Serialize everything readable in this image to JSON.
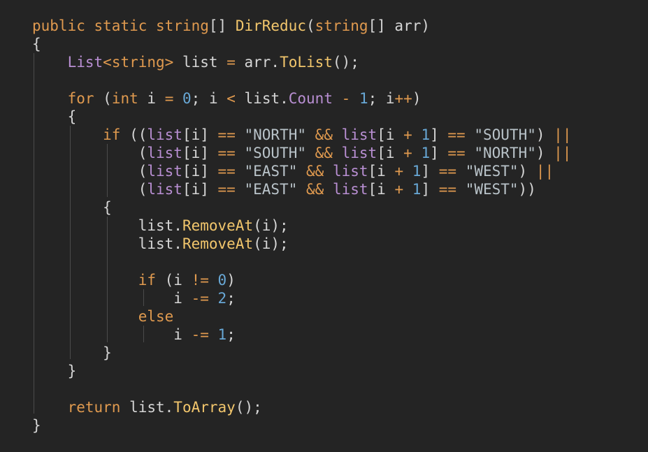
{
  "code": {
    "lines": [
      [
        {
          "t": "public",
          "c": "kw"
        },
        {
          "t": " ",
          "c": "pn"
        },
        {
          "t": "static",
          "c": "kw"
        },
        {
          "t": " ",
          "c": "pn"
        },
        {
          "t": "string",
          "c": "kw"
        },
        {
          "t": "[] ",
          "c": "pn"
        },
        {
          "t": "DirReduc",
          "c": "fn"
        },
        {
          "t": "(",
          "c": "pn"
        },
        {
          "t": "string",
          "c": "kw"
        },
        {
          "t": "[] arr)",
          "c": "pn"
        }
      ],
      [
        {
          "t": "{",
          "c": "pn"
        }
      ],
      [
        {
          "t": "    ",
          "c": "pn"
        },
        {
          "t": "List",
          "c": "ty"
        },
        {
          "t": "<",
          "c": "op"
        },
        {
          "t": "string",
          "c": "kw"
        },
        {
          "t": ">",
          "c": "op"
        },
        {
          "t": " list ",
          "c": "pn"
        },
        {
          "t": "=",
          "c": "op"
        },
        {
          "t": " arr.",
          "c": "pn"
        },
        {
          "t": "ToList",
          "c": "fn"
        },
        {
          "t": "();",
          "c": "pn"
        }
      ],
      [],
      [
        {
          "t": "    ",
          "c": "pn"
        },
        {
          "t": "for",
          "c": "kw"
        },
        {
          "t": " (",
          "c": "pn"
        },
        {
          "t": "int",
          "c": "kw"
        },
        {
          "t": " i ",
          "c": "pn"
        },
        {
          "t": "=",
          "c": "op"
        },
        {
          "t": " ",
          "c": "pn"
        },
        {
          "t": "0",
          "c": "num"
        },
        {
          "t": "; i ",
          "c": "pn"
        },
        {
          "t": "<",
          "c": "op"
        },
        {
          "t": " list.",
          "c": "pn"
        },
        {
          "t": "Count",
          "c": "ty"
        },
        {
          "t": " ",
          "c": "pn"
        },
        {
          "t": "-",
          "c": "op"
        },
        {
          "t": " ",
          "c": "pn"
        },
        {
          "t": "1",
          "c": "num"
        },
        {
          "t": "; i",
          "c": "pn"
        },
        {
          "t": "++",
          "c": "op"
        },
        {
          "t": ")",
          "c": "pn"
        }
      ],
      [
        {
          "t": "    {",
          "c": "pn"
        }
      ],
      [
        {
          "t": "        ",
          "c": "pn"
        },
        {
          "t": "if",
          "c": "kw"
        },
        {
          "t": " ((",
          "c": "pn"
        },
        {
          "t": "list",
          "c": "ty"
        },
        {
          "t": "[i] ",
          "c": "pn"
        },
        {
          "t": "==",
          "c": "op"
        },
        {
          "t": " ",
          "c": "pn"
        },
        {
          "t": "\"NORTH\"",
          "c": "str"
        },
        {
          "t": " ",
          "c": "pn"
        },
        {
          "t": "&&",
          "c": "op"
        },
        {
          "t": " ",
          "c": "pn"
        },
        {
          "t": "list",
          "c": "ty"
        },
        {
          "t": "[i ",
          "c": "pn"
        },
        {
          "t": "+",
          "c": "op"
        },
        {
          "t": " ",
          "c": "pn"
        },
        {
          "t": "1",
          "c": "num"
        },
        {
          "t": "] ",
          "c": "pn"
        },
        {
          "t": "==",
          "c": "op"
        },
        {
          "t": " ",
          "c": "pn"
        },
        {
          "t": "\"SOUTH\"",
          "c": "str"
        },
        {
          "t": ") ",
          "c": "pn"
        },
        {
          "t": "||",
          "c": "op"
        }
      ],
      [
        {
          "t": "            (",
          "c": "pn"
        },
        {
          "t": "list",
          "c": "ty"
        },
        {
          "t": "[i] ",
          "c": "pn"
        },
        {
          "t": "==",
          "c": "op"
        },
        {
          "t": " ",
          "c": "pn"
        },
        {
          "t": "\"SOUTH\"",
          "c": "str"
        },
        {
          "t": " ",
          "c": "pn"
        },
        {
          "t": "&&",
          "c": "op"
        },
        {
          "t": " ",
          "c": "pn"
        },
        {
          "t": "list",
          "c": "ty"
        },
        {
          "t": "[i ",
          "c": "pn"
        },
        {
          "t": "+",
          "c": "op"
        },
        {
          "t": " ",
          "c": "pn"
        },
        {
          "t": "1",
          "c": "num"
        },
        {
          "t": "] ",
          "c": "pn"
        },
        {
          "t": "==",
          "c": "op"
        },
        {
          "t": " ",
          "c": "pn"
        },
        {
          "t": "\"NORTH\"",
          "c": "str"
        },
        {
          "t": ") ",
          "c": "pn"
        },
        {
          "t": "||",
          "c": "op"
        }
      ],
      [
        {
          "t": "            (",
          "c": "pn"
        },
        {
          "t": "list",
          "c": "ty"
        },
        {
          "t": "[i] ",
          "c": "pn"
        },
        {
          "t": "==",
          "c": "op"
        },
        {
          "t": " ",
          "c": "pn"
        },
        {
          "t": "\"EAST\"",
          "c": "str"
        },
        {
          "t": " ",
          "c": "pn"
        },
        {
          "t": "&&",
          "c": "op"
        },
        {
          "t": " ",
          "c": "pn"
        },
        {
          "t": "list",
          "c": "ty"
        },
        {
          "t": "[i ",
          "c": "pn"
        },
        {
          "t": "+",
          "c": "op"
        },
        {
          "t": " ",
          "c": "pn"
        },
        {
          "t": "1",
          "c": "num"
        },
        {
          "t": "] ",
          "c": "pn"
        },
        {
          "t": "==",
          "c": "op"
        },
        {
          "t": " ",
          "c": "pn"
        },
        {
          "t": "\"WEST\"",
          "c": "str"
        },
        {
          "t": ") ",
          "c": "pn"
        },
        {
          "t": "||",
          "c": "op"
        }
      ],
      [
        {
          "t": "            (",
          "c": "pn"
        },
        {
          "t": "list",
          "c": "ty"
        },
        {
          "t": "[i] ",
          "c": "pn"
        },
        {
          "t": "==",
          "c": "op"
        },
        {
          "t": " ",
          "c": "pn"
        },
        {
          "t": "\"EAST\"",
          "c": "str"
        },
        {
          "t": " ",
          "c": "pn"
        },
        {
          "t": "&&",
          "c": "op"
        },
        {
          "t": " ",
          "c": "pn"
        },
        {
          "t": "list",
          "c": "ty"
        },
        {
          "t": "[i ",
          "c": "pn"
        },
        {
          "t": "+",
          "c": "op"
        },
        {
          "t": " ",
          "c": "pn"
        },
        {
          "t": "1",
          "c": "num"
        },
        {
          "t": "] ",
          "c": "pn"
        },
        {
          "t": "==",
          "c": "op"
        },
        {
          "t": " ",
          "c": "pn"
        },
        {
          "t": "\"WEST\"",
          "c": "str"
        },
        {
          "t": "))",
          "c": "pn"
        }
      ],
      [
        {
          "t": "        {",
          "c": "pn"
        }
      ],
      [
        {
          "t": "            list.",
          "c": "pn"
        },
        {
          "t": "RemoveAt",
          "c": "fn"
        },
        {
          "t": "(i);",
          "c": "pn"
        }
      ],
      [
        {
          "t": "            list.",
          "c": "pn"
        },
        {
          "t": "RemoveAt",
          "c": "fn"
        },
        {
          "t": "(i);",
          "c": "pn"
        }
      ],
      [],
      [
        {
          "t": "            ",
          "c": "pn"
        },
        {
          "t": "if",
          "c": "kw"
        },
        {
          "t": " (i ",
          "c": "pn"
        },
        {
          "t": "!=",
          "c": "op"
        },
        {
          "t": " ",
          "c": "pn"
        },
        {
          "t": "0",
          "c": "num"
        },
        {
          "t": ")",
          "c": "pn"
        }
      ],
      [
        {
          "t": "                i ",
          "c": "pn"
        },
        {
          "t": "-=",
          "c": "op"
        },
        {
          "t": " ",
          "c": "pn"
        },
        {
          "t": "2",
          "c": "num"
        },
        {
          "t": ";",
          "c": "pn"
        }
      ],
      [
        {
          "t": "            ",
          "c": "pn"
        },
        {
          "t": "else",
          "c": "kw"
        }
      ],
      [
        {
          "t": "                i ",
          "c": "pn"
        },
        {
          "t": "-=",
          "c": "op"
        },
        {
          "t": " ",
          "c": "pn"
        },
        {
          "t": "1",
          "c": "num"
        },
        {
          "t": ";",
          "c": "pn"
        }
      ],
      [
        {
          "t": "        }",
          "c": "pn"
        }
      ],
      [
        {
          "t": "    }",
          "c": "pn"
        }
      ],
      [],
      [
        {
          "t": "    ",
          "c": "pn"
        },
        {
          "t": "return",
          "c": "kw"
        },
        {
          "t": " list.",
          "c": "pn"
        },
        {
          "t": "ToArray",
          "c": "fn"
        },
        {
          "t": "();",
          "c": "pn"
        }
      ],
      [
        {
          "t": "}",
          "c": "pn"
        }
      ]
    ]
  },
  "colors": {
    "background": "#242424",
    "keyword": "#e09a4f",
    "function": "#f2c66c",
    "type": "#b98fd3",
    "string": "#b9c3c9",
    "number": "#68a8d6",
    "text": "#d6d6d6",
    "indent_guide": "#4b4b4b"
  }
}
